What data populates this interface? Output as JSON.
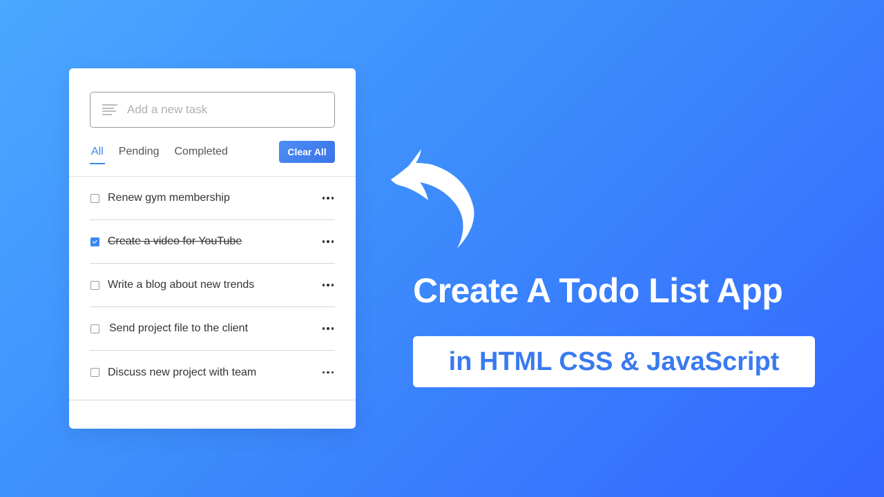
{
  "todo_app": {
    "input": {
      "placeholder": "Add a new task",
      "value": ""
    },
    "filters": [
      {
        "label": "All",
        "active": true
      },
      {
        "label": "Pending",
        "active": false
      },
      {
        "label": "Completed",
        "active": false
      }
    ],
    "clear_all_label": "Clear All",
    "tasks": [
      {
        "label": "Renew gym membership",
        "completed": false
      },
      {
        "label": "Create a video for YouTube",
        "completed": true
      },
      {
        "label": "Write a blog about new trends",
        "completed": false
      },
      {
        "label": "Send project file to the client",
        "completed": false
      },
      {
        "label": "Discuss new project with team",
        "completed": false
      }
    ],
    "accent_color": "#3c87e8"
  },
  "banner": {
    "headline": "Create A Todo List App",
    "subtitle": "in HTML CSS & JavaScript",
    "arrow_icon": "curved-arrow-left-icon"
  },
  "colors": {
    "background_start": "#4aa8ff",
    "background_end": "#3366ff",
    "subtitle_text": "#3a7af0"
  }
}
